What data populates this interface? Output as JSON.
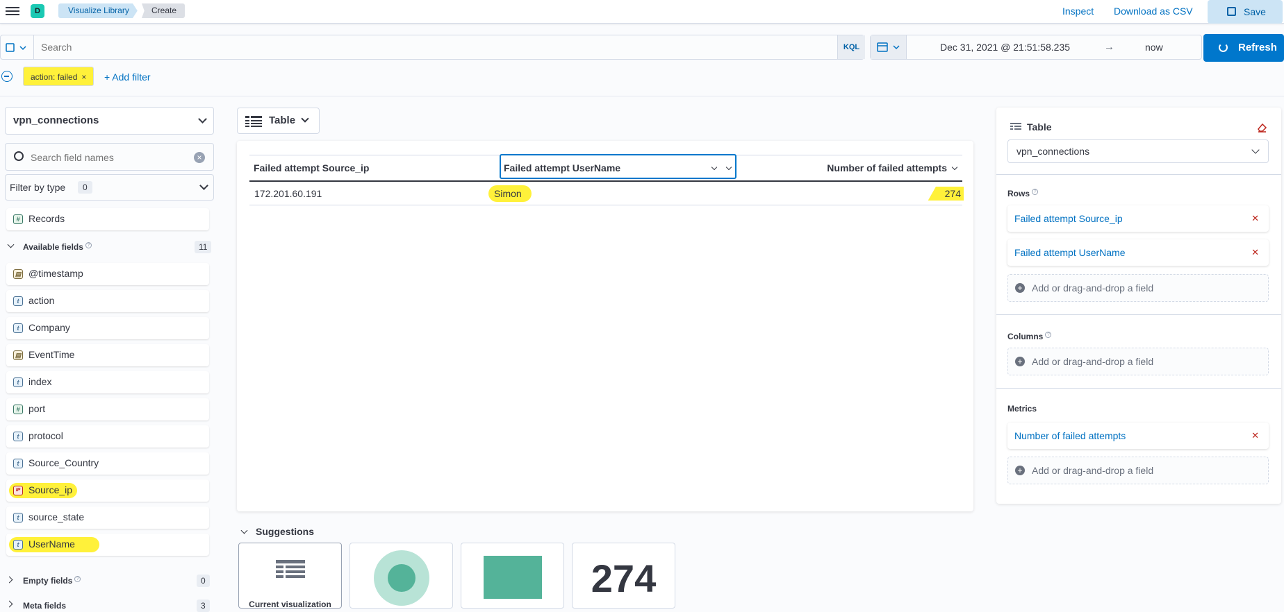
{
  "header": {
    "space_initial": "D",
    "breadcrumbs": [
      "Visualize Library",
      "Create"
    ],
    "inspect": "Inspect",
    "download": "Download as CSV",
    "save": "Save"
  },
  "query": {
    "placeholder": "Search",
    "language": "KQL",
    "date_start": "Dec 31, 2021 @ 21:51:58.235",
    "date_arrow": "→",
    "date_end": "now",
    "refresh": "Refresh"
  },
  "filters": {
    "pill": "action: failed",
    "add": "+ Add filter"
  },
  "sidebar": {
    "index": "vpn_connections",
    "search_placeholder": "Search field names",
    "filter_type": "Filter by type",
    "filter_count": "0",
    "records": "Records",
    "available_label": "Available fields",
    "available_count": "11",
    "fields": [
      {
        "name": "@timestamp",
        "type": "date"
      },
      {
        "name": "action",
        "type": "text"
      },
      {
        "name": "Company",
        "type": "text"
      },
      {
        "name": "EventTime",
        "type": "date"
      },
      {
        "name": "index",
        "type": "text"
      },
      {
        "name": "port",
        "type": "number"
      },
      {
        "name": "protocol",
        "type": "text"
      },
      {
        "name": "Source_Country",
        "type": "text"
      },
      {
        "name": "Source_ip",
        "type": "ip"
      },
      {
        "name": "source_state",
        "type": "text"
      },
      {
        "name": "UserName",
        "type": "text"
      }
    ],
    "empty_label": "Empty fields",
    "empty_count": "0",
    "meta_label": "Meta fields",
    "meta_count": "3"
  },
  "workspace": {
    "vis_type": "Table",
    "columns": [
      "Failed attempt Source_ip",
      "Failed attempt UserName",
      "Number of failed attempts"
    ],
    "rows": [
      [
        "172.201.60.191",
        "Simon",
        "274"
      ]
    ]
  },
  "suggestions": {
    "title": "Suggestions",
    "current": "Current visualization",
    "metric_value": "274",
    "colors": {
      "ring": "#b8e3d6",
      "dot": "#54b399",
      "square": "#54b399"
    }
  },
  "config": {
    "title": "Table",
    "layer": "vpn_connections",
    "rows_label": "Rows",
    "rows": [
      "Failed attempt Source_ip",
      "Failed attempt UserName"
    ],
    "columns_label": "Columns",
    "metrics_label": "Metrics",
    "metrics": [
      "Number of failed attempts"
    ],
    "add_label": "Add or drag-and-drop a field"
  }
}
